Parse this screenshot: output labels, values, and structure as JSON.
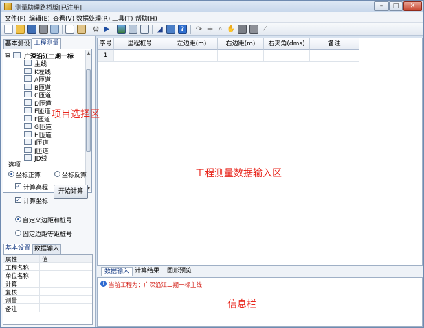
{
  "window": {
    "title": "测量助理路桥版[已注册]",
    "controls": {
      "minimize": "–",
      "maximize": "□",
      "close": "✕"
    }
  },
  "menu": [
    {
      "label": "文件(F)"
    },
    {
      "label": "编辑(E)"
    },
    {
      "label": "查看(V)"
    },
    {
      "label": "数据处理(R)"
    },
    {
      "label": "工具(T)"
    },
    {
      "label": "帮助(H)"
    }
  ],
  "toolbar": {
    "icons": [
      "new-file-icon",
      "open-folder-icon",
      "save-icon",
      "print-icon",
      "print-preview-icon",
      "copy-icon",
      "paste-icon",
      "settings-gear-icon",
      "run-play-icon",
      "image-icon",
      "calculator-icon",
      "edit-icon",
      "flag-icon",
      "network-icon",
      "help-icon",
      "line-icon",
      "crosshair-icon",
      "zoom-icon",
      "pan-hand-icon",
      "fill-icon",
      "rect-icon",
      "measure-icon"
    ]
  },
  "left_tabs": [
    {
      "label": "基本测设"
    },
    {
      "label": "工程测量"
    }
  ],
  "tree": {
    "root": "广深沿江二期一标",
    "expander": "⊟",
    "items": [
      "主线",
      "K左线",
      "A匝道",
      "B匝道",
      "C匝道",
      "D匝道",
      "E匝道",
      "F匝道",
      "G匝道",
      "H匝道",
      "I匝道",
      "J匝道",
      "JD线"
    ]
  },
  "annotations": {
    "project_select": "项目选择区",
    "data_input": "工程测量数据输入区",
    "info_bar": "信息栏"
  },
  "options": {
    "label": "选项",
    "forward": "坐标正算",
    "inverse": "坐标反算",
    "calc_elevation": "计算高程",
    "calc_coords": "计算坐标",
    "start_button": "开始计算",
    "custom_offset": "自定义边距和桩号",
    "fixed_offset": "固定边距等距桩号"
  },
  "bottom_left_tabs": [
    {
      "label": "基本设置"
    },
    {
      "label": "数据输入"
    }
  ],
  "properties": {
    "header_name": "属性",
    "header_value": "值",
    "rows": [
      "工程名称",
      "单位名称",
      "计算",
      "复核",
      "测量",
      "备注"
    ]
  },
  "grid": {
    "columns": [
      "序号",
      "里程桩号",
      "左边距(m)",
      "右边距(m)",
      "右夹角(dms)",
      "备注"
    ],
    "rows": [
      [
        "1",
        "",
        "",
        "",
        "",
        ""
      ]
    ]
  },
  "bottom_tabs": [
    {
      "label": "数据输入"
    },
    {
      "label": "计算结果"
    },
    {
      "label": "图形预览"
    }
  ],
  "info": {
    "message": "当前工程为：广深沿江二期一标主线"
  }
}
